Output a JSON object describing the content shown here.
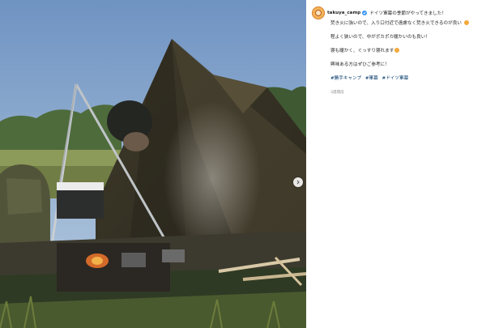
{
  "post": {
    "username": "takuya_camp",
    "first_line": "ドイツ軍幕の季節がやってきました！",
    "lines": [
      "焚き火に強いので、入り口付近で遠慮なく焚き火できるのが良い",
      "程よく狭いので、中がポカポカ暖かいのも良い！",
      "寝も暖かく、ぐっすり寝れます",
      "興味ある方はぜひご参考に！"
    ],
    "hashtags": [
      "#勝手キャンプ",
      "#軍幕",
      "#ドイツ軍幕"
    ],
    "time_ago": "3週間前"
  },
  "icons": {
    "verified": "verified-badge-icon",
    "carousel_next": "chevron-right-icon",
    "emoji": "smiling-face-emoji"
  },
  "colors": {
    "link": "#00376b",
    "text": "#262626",
    "verified": "#3897f0",
    "muted": "#8e8e8e"
  }
}
